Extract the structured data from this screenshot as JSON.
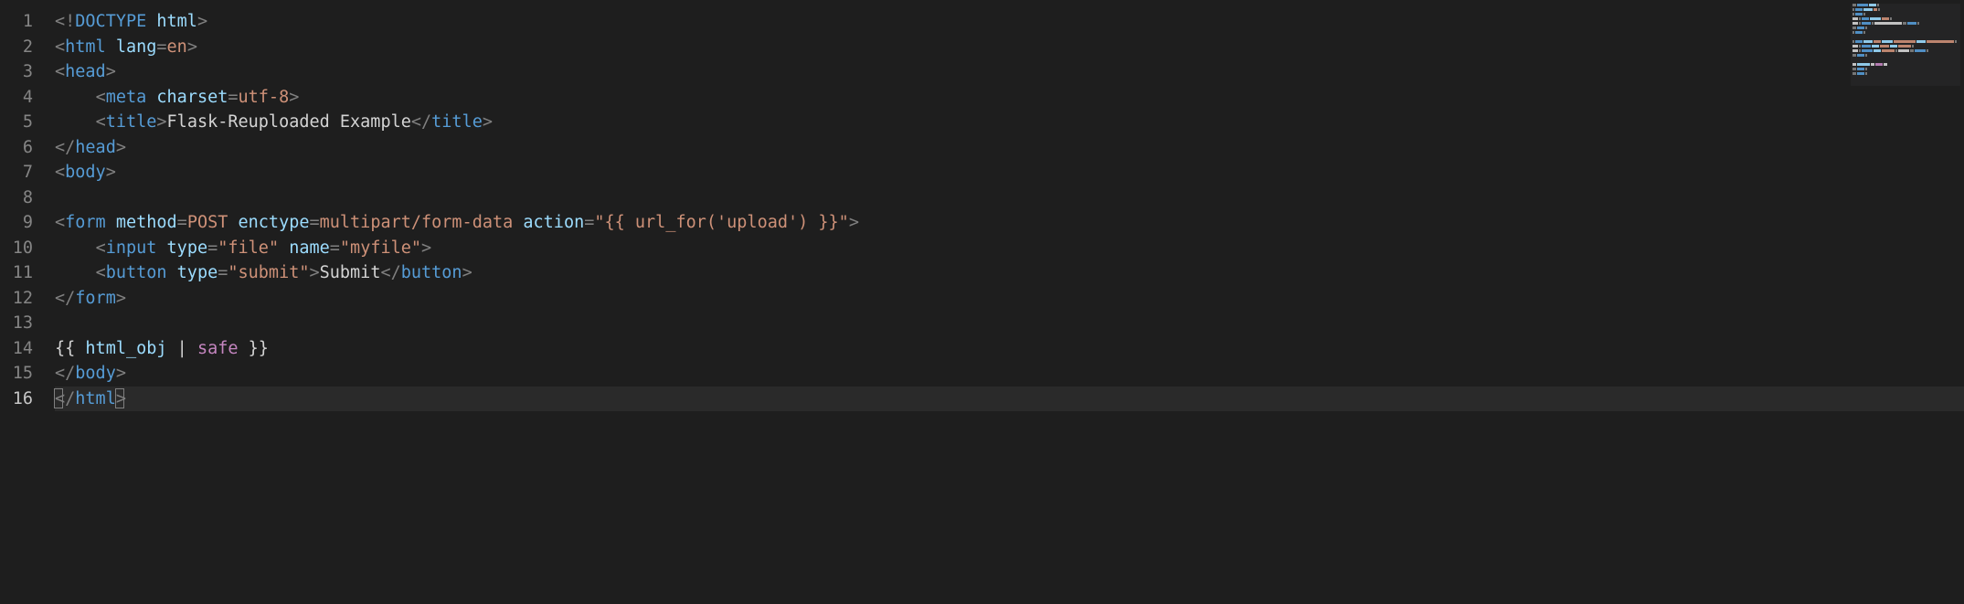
{
  "line_numbers": [
    "1",
    "2",
    "3",
    "4",
    "5",
    "6",
    "7",
    "8",
    "9",
    "10",
    "11",
    "12",
    "13",
    "14",
    "15",
    "16"
  ],
  "active_line_index": 15,
  "code_lines": [
    {
      "indent": 0,
      "tokens": [
        {
          "c": "p",
          "t": "<!"
        },
        {
          "c": "d",
          "t": "DOCTYPE"
        },
        {
          "c": "tx",
          "t": " "
        },
        {
          "c": "a",
          "t": "html"
        },
        {
          "c": "p",
          "t": ">"
        }
      ]
    },
    {
      "indent": 0,
      "tokens": [
        {
          "c": "p",
          "t": "<"
        },
        {
          "c": "t",
          "t": "html"
        },
        {
          "c": "tx",
          "t": " "
        },
        {
          "c": "a",
          "t": "lang"
        },
        {
          "c": "p",
          "t": "="
        },
        {
          "c": "v",
          "t": "en"
        },
        {
          "c": "p",
          "t": ">"
        }
      ]
    },
    {
      "indent": 0,
      "tokens": [
        {
          "c": "p",
          "t": "<"
        },
        {
          "c": "t",
          "t": "head"
        },
        {
          "c": "p",
          "t": ">"
        }
      ]
    },
    {
      "indent": 1,
      "tokens": [
        {
          "c": "p",
          "t": "<"
        },
        {
          "c": "t",
          "t": "meta"
        },
        {
          "c": "tx",
          "t": " "
        },
        {
          "c": "a",
          "t": "charset"
        },
        {
          "c": "p",
          "t": "="
        },
        {
          "c": "v",
          "t": "utf-8"
        },
        {
          "c": "p",
          "t": ">"
        }
      ]
    },
    {
      "indent": 1,
      "tokens": [
        {
          "c": "p",
          "t": "<"
        },
        {
          "c": "t",
          "t": "title"
        },
        {
          "c": "p",
          "t": ">"
        },
        {
          "c": "tx",
          "t": "Flask-Reuploaded Example"
        },
        {
          "c": "p",
          "t": "</"
        },
        {
          "c": "t",
          "t": "title"
        },
        {
          "c": "p",
          "t": ">"
        }
      ]
    },
    {
      "indent": 0,
      "tokens": [
        {
          "c": "p",
          "t": "</"
        },
        {
          "c": "t",
          "t": "head"
        },
        {
          "c": "p",
          "t": ">"
        }
      ]
    },
    {
      "indent": 0,
      "tokens": [
        {
          "c": "p",
          "t": "<"
        },
        {
          "c": "t",
          "t": "body"
        },
        {
          "c": "p",
          "t": ">"
        }
      ]
    },
    {
      "indent": 0,
      "tokens": []
    },
    {
      "indent": 0,
      "tokens": [
        {
          "c": "p",
          "t": "<"
        },
        {
          "c": "t",
          "t": "form"
        },
        {
          "c": "tx",
          "t": " "
        },
        {
          "c": "a",
          "t": "method"
        },
        {
          "c": "p",
          "t": "="
        },
        {
          "c": "v",
          "t": "POST"
        },
        {
          "c": "tx",
          "t": " "
        },
        {
          "c": "a",
          "t": "enctype"
        },
        {
          "c": "p",
          "t": "="
        },
        {
          "c": "v",
          "t": "multipart/form-data"
        },
        {
          "c": "tx",
          "t": " "
        },
        {
          "c": "a",
          "t": "action"
        },
        {
          "c": "p",
          "t": "="
        },
        {
          "c": "v",
          "t": "\"{{ url_for('upload') }}\""
        },
        {
          "c": "p",
          "t": ">"
        }
      ]
    },
    {
      "indent": 1,
      "tokens": [
        {
          "c": "p",
          "t": "<"
        },
        {
          "c": "t",
          "t": "input"
        },
        {
          "c": "tx",
          "t": " "
        },
        {
          "c": "a",
          "t": "type"
        },
        {
          "c": "p",
          "t": "="
        },
        {
          "c": "v",
          "t": "\"file\""
        },
        {
          "c": "tx",
          "t": " "
        },
        {
          "c": "a",
          "t": "name"
        },
        {
          "c": "p",
          "t": "="
        },
        {
          "c": "v",
          "t": "\"myfile\""
        },
        {
          "c": "p",
          "t": ">"
        }
      ]
    },
    {
      "indent": 1,
      "tokens": [
        {
          "c": "p",
          "t": "<"
        },
        {
          "c": "t",
          "t": "button"
        },
        {
          "c": "tx",
          "t": " "
        },
        {
          "c": "a",
          "t": "type"
        },
        {
          "c": "p",
          "t": "="
        },
        {
          "c": "v",
          "t": "\"submit\""
        },
        {
          "c": "p",
          "t": ">"
        },
        {
          "c": "tx",
          "t": "Submit"
        },
        {
          "c": "p",
          "t": "</"
        },
        {
          "c": "t",
          "t": "button"
        },
        {
          "c": "p",
          "t": ">"
        }
      ]
    },
    {
      "indent": 0,
      "tokens": [
        {
          "c": "p",
          "t": "</"
        },
        {
          "c": "t",
          "t": "form"
        },
        {
          "c": "p",
          "t": ">"
        }
      ]
    },
    {
      "indent": 0,
      "tokens": []
    },
    {
      "indent": 0,
      "tokens": [
        {
          "c": "jd",
          "t": "{{ "
        },
        {
          "c": "jv",
          "t": "html_obj"
        },
        {
          "c": "jd",
          "t": " | "
        },
        {
          "c": "jf",
          "t": "safe"
        },
        {
          "c": "jd",
          "t": " }}"
        }
      ]
    },
    {
      "indent": 0,
      "tokens": [
        {
          "c": "p",
          "t": "</"
        },
        {
          "c": "t",
          "t": "body"
        },
        {
          "c": "p",
          "t": ">"
        }
      ]
    },
    {
      "indent": 0,
      "active": true,
      "bracket_left": true,
      "tokens_end": [
        {
          "c": "p",
          "t": "/"
        },
        {
          "c": "t",
          "t": "html"
        }
      ],
      "bracket_right": true
    }
  ],
  "indent_unit": "    ",
  "minimap_widths": [
    [
      [
        "mm-p",
        4
      ],
      [
        "mm-t",
        12
      ],
      [
        "mm-a",
        8
      ],
      [
        "mm-p",
        2
      ]
    ],
    [
      [
        "mm-p",
        2
      ],
      [
        "mm-t",
        8
      ],
      [
        "mm-a",
        10
      ],
      [
        "mm-v",
        4
      ],
      [
        "mm-p",
        2
      ]
    ],
    [
      [
        "mm-p",
        2
      ],
      [
        "mm-t",
        8
      ],
      [
        "mm-p",
        2
      ]
    ],
    [
      [
        "mm-x",
        6
      ],
      [
        "mm-p",
        2
      ],
      [
        "mm-t",
        8
      ],
      [
        "mm-a",
        12
      ],
      [
        "mm-v",
        8
      ],
      [
        "mm-p",
        2
      ]
    ],
    [
      [
        "mm-x",
        6
      ],
      [
        "mm-p",
        2
      ],
      [
        "mm-t",
        10
      ],
      [
        "mm-p",
        2
      ],
      [
        "mm-x",
        30
      ],
      [
        "mm-p",
        4
      ],
      [
        "mm-t",
        10
      ],
      [
        "mm-p",
        2
      ]
    ],
    [
      [
        "mm-p",
        4
      ],
      [
        "mm-t",
        8
      ],
      [
        "mm-p",
        2
      ]
    ],
    [
      [
        "mm-p",
        2
      ],
      [
        "mm-t",
        8
      ],
      [
        "mm-p",
        2
      ]
    ],
    [],
    [
      [
        "mm-p",
        2
      ],
      [
        "mm-t",
        8
      ],
      [
        "mm-a",
        10
      ],
      [
        "mm-v",
        8
      ],
      [
        "mm-a",
        12
      ],
      [
        "mm-v",
        24
      ],
      [
        "mm-a",
        10
      ],
      [
        "mm-v",
        30
      ],
      [
        "mm-p",
        2
      ]
    ],
    [
      [
        "mm-x",
        6
      ],
      [
        "mm-p",
        2
      ],
      [
        "mm-t",
        10
      ],
      [
        "mm-a",
        8
      ],
      [
        "mm-v",
        10
      ],
      [
        "mm-a",
        8
      ],
      [
        "mm-v",
        14
      ],
      [
        "mm-p",
        2
      ]
    ],
    [
      [
        "mm-x",
        6
      ],
      [
        "mm-p",
        2
      ],
      [
        "mm-t",
        12
      ],
      [
        "mm-a",
        8
      ],
      [
        "mm-v",
        14
      ],
      [
        "mm-p",
        2
      ],
      [
        "mm-x",
        12
      ],
      [
        "mm-p",
        4
      ],
      [
        "mm-t",
        12
      ],
      [
        "mm-p",
        2
      ]
    ],
    [
      [
        "mm-p",
        4
      ],
      [
        "mm-t",
        8
      ],
      [
        "mm-p",
        2
      ]
    ],
    [],
    [
      [
        "mm-x",
        4
      ],
      [
        "mm-a",
        14
      ],
      [
        "mm-x",
        4
      ],
      [
        "mm-f",
        8
      ],
      [
        "mm-x",
        4
      ]
    ],
    [
      [
        "mm-p",
        4
      ],
      [
        "mm-t",
        8
      ],
      [
        "mm-p",
        2
      ]
    ],
    [
      [
        "mm-p",
        4
      ],
      [
        "mm-t",
        8
      ],
      [
        "mm-p",
        2
      ]
    ]
  ]
}
